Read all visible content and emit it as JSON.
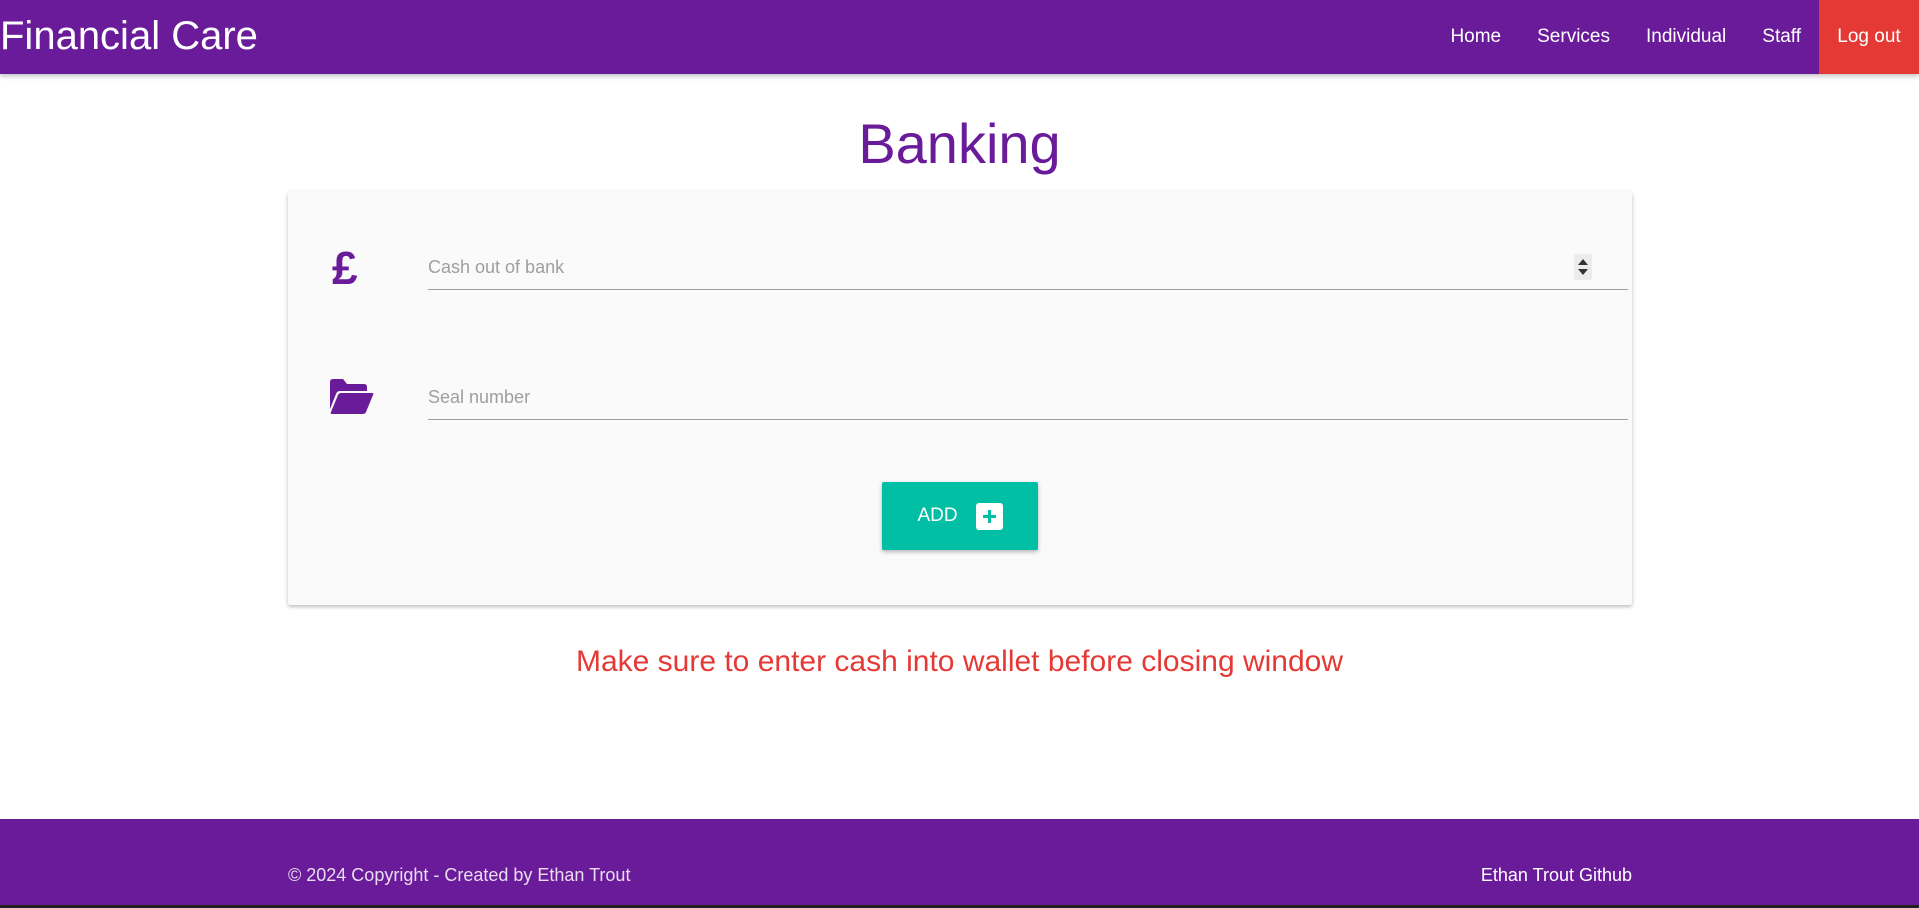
{
  "navbar": {
    "brand": "Financial Care",
    "links": [
      {
        "label": "Home"
      },
      {
        "label": "Services"
      },
      {
        "label": "Individual"
      },
      {
        "label": "Staff"
      }
    ],
    "logout_label": "Log out",
    "bg_color": "#6a1b9a",
    "logout_color": "#e53935"
  },
  "main": {
    "title": "Banking",
    "form": {
      "cash_field": {
        "icon": "pound-sign-icon",
        "icon_glyph": "£",
        "placeholder": "Cash out of bank",
        "value": ""
      },
      "seal_field": {
        "icon": "folder-open-icon",
        "placeholder": "Seal number",
        "value": ""
      },
      "add_button": {
        "label": "ADD",
        "icon": "plus-square-icon",
        "color": "#00bfa5"
      }
    },
    "warning": "Make sure to enter cash into wallet before closing window"
  },
  "footer": {
    "copyright": "© 2024 Copyright - Created by Ethan Trout",
    "github_label": "Ethan Trout Github"
  }
}
